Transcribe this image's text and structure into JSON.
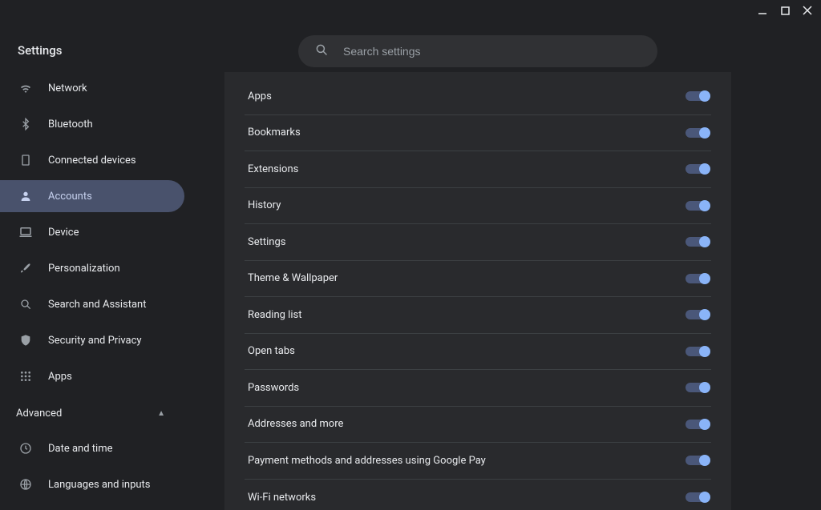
{
  "window": {
    "title": "Settings"
  },
  "search": {
    "placeholder": "Search settings"
  },
  "sidebar": {
    "items": [
      {
        "id": "network",
        "label": "Network",
        "icon": "wifi",
        "active": false
      },
      {
        "id": "bluetooth",
        "label": "Bluetooth",
        "icon": "bluetooth",
        "active": false
      },
      {
        "id": "connected",
        "label": "Connected devices",
        "icon": "devices",
        "active": false
      },
      {
        "id": "accounts",
        "label": "Accounts",
        "icon": "person",
        "active": true
      },
      {
        "id": "device",
        "label": "Device",
        "icon": "laptop",
        "active": false
      },
      {
        "id": "personalization",
        "label": "Personalization",
        "icon": "brush",
        "active": false
      },
      {
        "id": "search-assistant",
        "label": "Search and Assistant",
        "icon": "search",
        "active": false
      },
      {
        "id": "security",
        "label": "Security and Privacy",
        "icon": "shield",
        "active": false
      },
      {
        "id": "apps",
        "label": "Apps",
        "icon": "grid",
        "active": false
      }
    ],
    "advanced": {
      "label": "Advanced",
      "expanded": true,
      "items": [
        {
          "id": "datetime",
          "label": "Date and time",
          "icon": "clock"
        },
        {
          "id": "lang",
          "label": "Languages and inputs",
          "icon": "globe"
        }
      ]
    }
  },
  "sync": {
    "rows": [
      {
        "id": "apps",
        "label": "Apps",
        "on": true
      },
      {
        "id": "bookmarks",
        "label": "Bookmarks",
        "on": true
      },
      {
        "id": "extensions",
        "label": "Extensions",
        "on": true
      },
      {
        "id": "history",
        "label": "History",
        "on": true
      },
      {
        "id": "settings",
        "label": "Settings",
        "on": true
      },
      {
        "id": "theme",
        "label": "Theme & Wallpaper",
        "on": true
      },
      {
        "id": "reading",
        "label": "Reading list",
        "on": true
      },
      {
        "id": "tabs",
        "label": "Open tabs",
        "on": true
      },
      {
        "id": "passwords",
        "label": "Passwords",
        "on": true
      },
      {
        "id": "addresses",
        "label": "Addresses and more",
        "on": true
      },
      {
        "id": "payment",
        "label": "Payment methods and addresses using Google Pay",
        "on": true
      },
      {
        "id": "wifi",
        "label": "Wi-Fi networks",
        "on": true
      }
    ]
  }
}
